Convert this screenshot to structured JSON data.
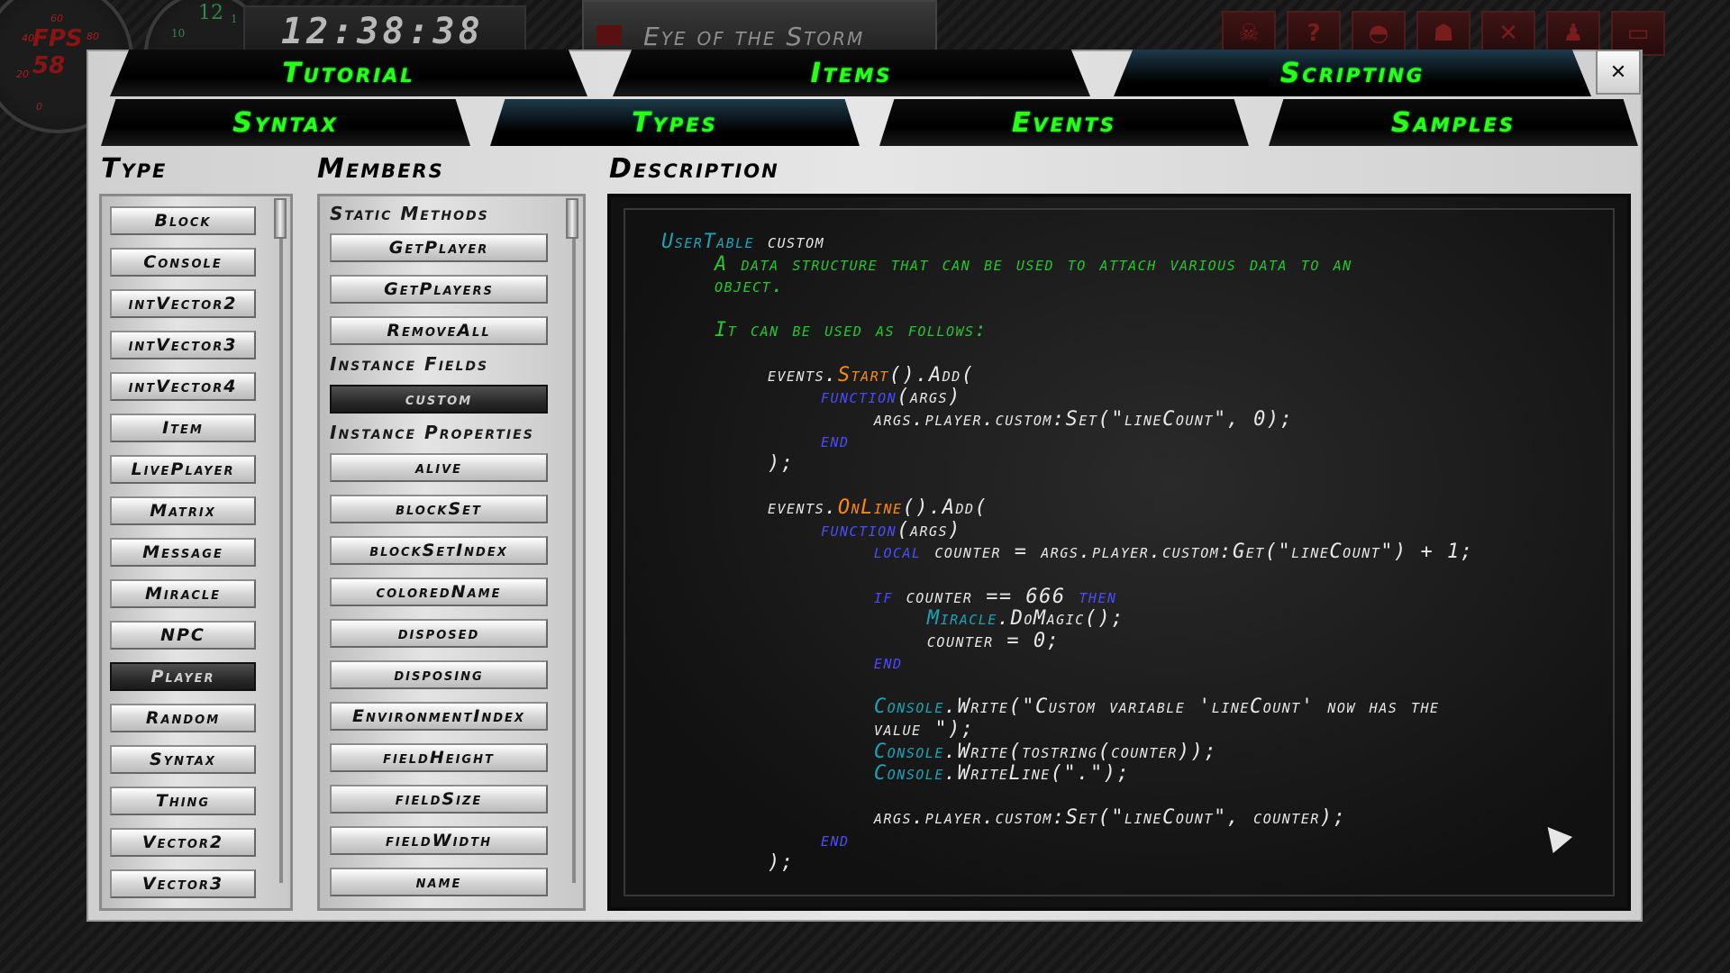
{
  "hud": {
    "fps_label": "FPS",
    "fps_value": "58",
    "fps_ticks": [
      "20",
      "40",
      "60",
      "80",
      "0"
    ],
    "clock_gauge_value": "12",
    "clock_ticks": [
      "10",
      "1",
      "2"
    ],
    "time": "12:38:38",
    "map_title": "Eye of the Storm",
    "icons": [
      "skull-icon",
      "help-icon",
      "helmet-icon",
      "users-icon",
      "tools-icon",
      "person-icon",
      "monitor-icon"
    ]
  },
  "tabs_top": [
    "Tutorial",
    "Items",
    "Scripting"
  ],
  "tabs_sub": [
    "Syntax",
    "Types",
    "Events",
    "Samples"
  ],
  "active_top": "Scripting",
  "close_label": "✕",
  "headers": {
    "type": "Type",
    "members": "Members",
    "description": "Description"
  },
  "types": [
    "Block",
    "Console",
    "intVector2",
    "intVector3",
    "intVector4",
    "Item",
    "LivePlayer",
    "Matrix",
    "Message",
    "Miracle",
    "NPC",
    "Player",
    "Random",
    "Syntax",
    "Thing",
    "Vector2",
    "Vector3"
  ],
  "selected_type": "Player",
  "members": {
    "static_methods_label": "Static Methods",
    "static_methods": [
      "GetPlayer",
      "GetPlayers",
      "RemoveAll"
    ],
    "instance_fields_label": "Instance Fields",
    "instance_fields": [
      "custom"
    ],
    "instance_properties_label": "Instance Properties",
    "instance_properties": [
      "alive",
      "blockSet",
      "blockSetIndex",
      "coloredName",
      "disposed",
      "disposing",
      "EnvironmentIndex",
      "fieldHeight",
      "fieldSize",
      "fieldWidth",
      "name"
    ],
    "selected_member": "custom"
  },
  "description": {
    "type_name": "UserTable",
    "member_name": "custom",
    "summary_1": "A data structure that can be used to attach various data to an",
    "summary_2": "object.",
    "usage": "It can be used as follows:",
    "code": [
      "events.Start().Add(",
      "function(args)",
      "args.player.custom:Set(\"lineCount\", 0);",
      "end",
      ");",
      "events.OnLine().Add(",
      "function(args)",
      "local counter = args.player.custom:Get(\"lineCount\") + 1;",
      "if counter == 666 then",
      "Miracle.DoMagic();",
      "counter = 0;",
      "end",
      "Console.Write(\"Custom variable 'lineCount' now has the",
      "value \");",
      "Console.Write(tostring(counter));",
      "Console.WriteLine(\".\");",
      "args.player.custom:Set(\"lineCount\", counter);",
      "end",
      ");"
    ]
  },
  "colors": {
    "tab_text": "#2aff14",
    "type_color": "#13a6b8",
    "comment_color": "#22c82c",
    "keyword_color": "#4a4cff",
    "event_color": "#ff8c00"
  }
}
